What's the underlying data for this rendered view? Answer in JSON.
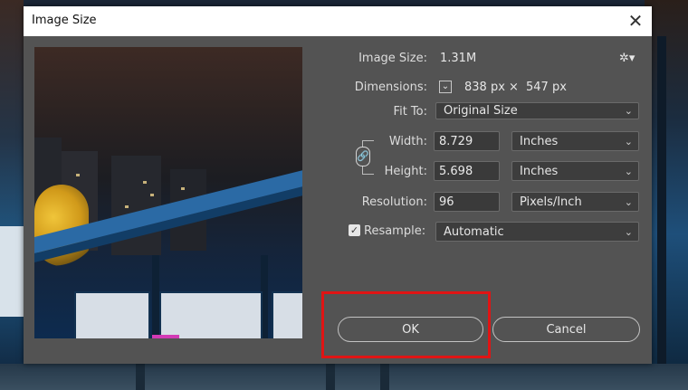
{
  "dialog": {
    "title": "Image Size",
    "close_label": "✕"
  },
  "fields": {
    "image_size_label": "Image Size:",
    "image_size_value": "1.31M",
    "dimensions_label": "Dimensions:",
    "dimensions_width": "838 px",
    "dimensions_sep": "×",
    "dimensions_height": "547 px",
    "fit_to_label": "Fit To:",
    "fit_to_value": "Original Size",
    "width_label": "Width:",
    "width_value": "8.729",
    "width_unit": "Inches",
    "height_label": "Height:",
    "height_value": "5.698",
    "height_unit": "Inches",
    "resolution_label": "Resolution:",
    "resolution_value": "96",
    "resolution_unit": "Pixels/Inch",
    "resample_label": "Resample:",
    "resample_value": "Automatic",
    "resample_checked": true
  },
  "buttons": {
    "ok": "OK",
    "cancel": "Cancel"
  },
  "icons": {
    "gear": "gear-icon",
    "chevron": "chevron-down-icon",
    "link": "link-icon"
  },
  "colors": {
    "dialog_bg": "#535353",
    "highlight": "#e01414"
  }
}
